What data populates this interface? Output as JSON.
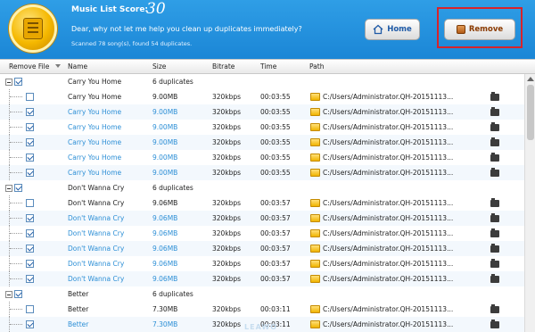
{
  "header": {
    "score_label": "Music List Score:",
    "score_value": "30",
    "message": "Dear, why not let me help you clean up duplicates immediately?",
    "summary": "Scanned 78 song(s), found 54 duplicates.",
    "home_label": "Home",
    "remove_label": "Remove"
  },
  "columns": [
    "Remove File",
    "Name",
    "Size",
    "Bitrate",
    "Time",
    "Path"
  ],
  "groups": [
    {
      "title": "Carry You Home",
      "count": "6 duplicates",
      "rows": [
        {
          "name": "Carry You Home",
          "size": "9.00MB",
          "bitrate": "320kbps",
          "time": "00:03:55",
          "path": "C:/Users/Administrator.QH-20151113...",
          "checked": false
        },
        {
          "name": "Carry You Home",
          "size": "9.00MB",
          "bitrate": "320kbps",
          "time": "00:03:55",
          "path": "C:/Users/Administrator.QH-20151113...",
          "checked": true
        },
        {
          "name": "Carry You Home",
          "size": "9.00MB",
          "bitrate": "320kbps",
          "time": "00:03:55",
          "path": "C:/Users/Administrator.QH-20151113...",
          "checked": true
        },
        {
          "name": "Carry You Home",
          "size": "9.00MB",
          "bitrate": "320kbps",
          "time": "00:03:55",
          "path": "C:/Users/Administrator.QH-20151113...",
          "checked": true
        },
        {
          "name": "Carry You Home",
          "size": "9.00MB",
          "bitrate": "320kbps",
          "time": "00:03:55",
          "path": "C:/Users/Administrator.QH-20151113...",
          "checked": true
        },
        {
          "name": "Carry You Home",
          "size": "9.00MB",
          "bitrate": "320kbps",
          "time": "00:03:55",
          "path": "C:/Users/Administrator.QH-20151113...",
          "checked": true
        }
      ]
    },
    {
      "title": "Don't Wanna Cry",
      "count": "6 duplicates",
      "rows": [
        {
          "name": "Don't Wanna Cry",
          "size": "9.06MB",
          "bitrate": "320kbps",
          "time": "00:03:57",
          "path": "C:/Users/Administrator.QH-20151113...",
          "checked": false
        },
        {
          "name": "Don't Wanna Cry",
          "size": "9.06MB",
          "bitrate": "320kbps",
          "time": "00:03:57",
          "path": "C:/Users/Administrator.QH-20151113...",
          "checked": true
        },
        {
          "name": "Don't Wanna Cry",
          "size": "9.06MB",
          "bitrate": "320kbps",
          "time": "00:03:57",
          "path": "C:/Users/Administrator.QH-20151113...",
          "checked": true
        },
        {
          "name": "Don't Wanna Cry",
          "size": "9.06MB",
          "bitrate": "320kbps",
          "time": "00:03:57",
          "path": "C:/Users/Administrator.QH-20151113...",
          "checked": true
        },
        {
          "name": "Don't Wanna Cry",
          "size": "9.06MB",
          "bitrate": "320kbps",
          "time": "00:03:57",
          "path": "C:/Users/Administrator.QH-20151113...",
          "checked": true
        },
        {
          "name": "Don't Wanna Cry",
          "size": "9.06MB",
          "bitrate": "320kbps",
          "time": "00:03:57",
          "path": "C:/Users/Administrator.QH-20151113...",
          "checked": true
        }
      ]
    },
    {
      "title": "Better",
      "count": "6 duplicates",
      "rows": [
        {
          "name": "Better",
          "size": "7.30MB",
          "bitrate": "320kbps",
          "time": "00:03:11",
          "path": "C:/Users/Administrator.QH-20151113...",
          "checked": false
        },
        {
          "name": "Better",
          "size": "7.30MB",
          "bitrate": "320kbps",
          "time": "00:03:11",
          "path": "C:/Users/Administrator.QH-20151113...",
          "checked": true
        }
      ]
    }
  ],
  "watermark": "LEAWO"
}
